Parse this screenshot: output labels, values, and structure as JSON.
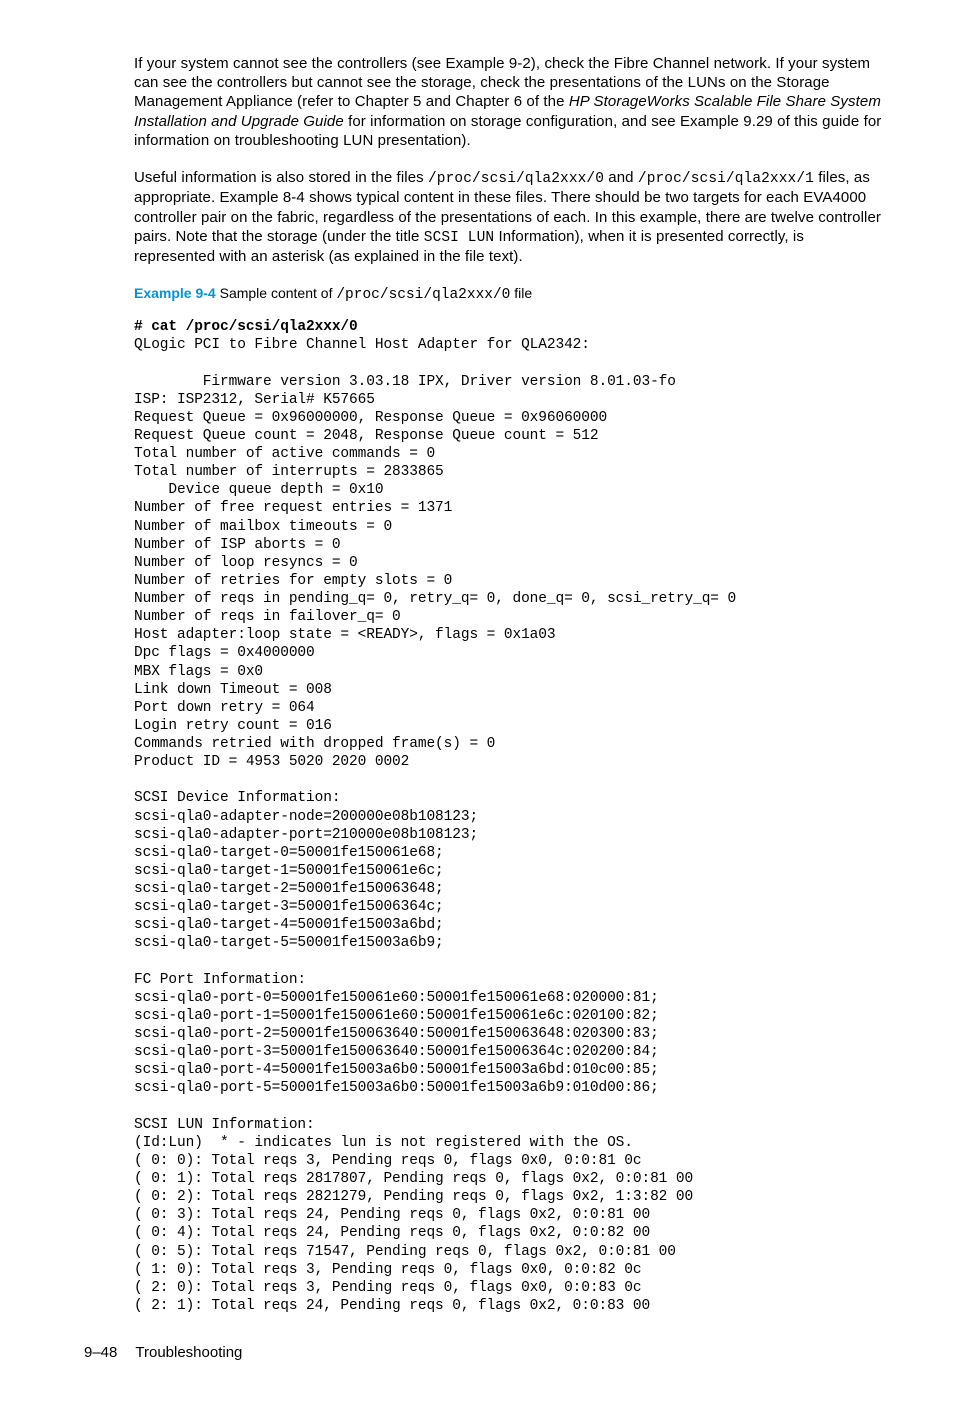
{
  "para1": {
    "t1": "If your system cannot see the controllers (see Example 9-2), check the Fibre Channel network. If your system can see the controllers but cannot see the storage, check the presentations of the LUNs on the Storage Management Appliance (refer to Chapter 5 and Chapter 6 of the ",
    "italic": "HP StorageWorks Scalable File Share System Installation and Upgrade Guide",
    "t2": " for information on storage configuration, and see Example 9.29 of this guide for information on troubleshooting LUN presentation)."
  },
  "para2": {
    "t1": "Useful information is also stored in the files ",
    "code1": "/proc/scsi/qla2xxx/0",
    "t2": " and ",
    "code2": "/proc/scsi/qla2xxx/1",
    "t3": " files, as appropriate. Example 8-4 shows typical content in these files. There should be two targets for each EVA4000 controller pair on the fabric, regardless of the presentations of each. In this example, there are twelve controller pairs. Note that the storage (under the title ",
    "code3": "SCSI LUN",
    "t4": " Information), when it is presented correctly, is represented with an asterisk (as explained in the file text)."
  },
  "example": {
    "label": "Example 9-4",
    "caption_pre": "  Sample content of ",
    "caption_code": "/proc/scsi/qla2xxx/0",
    "caption_post": " file"
  },
  "code": {
    "cmd": "# cat /proc/scsi/qla2xxx/0",
    "body": "QLogic PCI to Fibre Channel Host Adapter for QLA2342:\n\n        Firmware version 3.03.18 IPX, Driver version 8.01.03-fo\nISP: ISP2312, Serial# K57665\nRequest Queue = 0x96000000, Response Queue = 0x96060000\nRequest Queue count = 2048, Response Queue count = 512\nTotal number of active commands = 0\nTotal number of interrupts = 2833865\n    Device queue depth = 0x10\nNumber of free request entries = 1371\nNumber of mailbox timeouts = 0\nNumber of ISP aborts = 0\nNumber of loop resyncs = 0\nNumber of retries for empty slots = 0\nNumber of reqs in pending_q= 0, retry_q= 0, done_q= 0, scsi_retry_q= 0\nNumber of reqs in failover_q= 0\nHost adapter:loop state = <READY>, flags = 0x1a03\nDpc flags = 0x4000000\nMBX flags = 0x0\nLink down Timeout = 008\nPort down retry = 064\nLogin retry count = 016\nCommands retried with dropped frame(s) = 0\nProduct ID = 4953 5020 2020 0002\n\nSCSI Device Information:\nscsi-qla0-adapter-node=200000e08b108123;\nscsi-qla0-adapter-port=210000e08b108123;\nscsi-qla0-target-0=50001fe150061e68;\nscsi-qla0-target-1=50001fe150061e6c;\nscsi-qla0-target-2=50001fe150063648;\nscsi-qla0-target-3=50001fe15006364c;\nscsi-qla0-target-4=50001fe15003a6bd;\nscsi-qla0-target-5=50001fe15003a6b9;\n\nFC Port Information:\nscsi-qla0-port-0=50001fe150061e60:50001fe150061e68:020000:81;\nscsi-qla0-port-1=50001fe150061e60:50001fe150061e6c:020100:82;\nscsi-qla0-port-2=50001fe150063640:50001fe150063648:020300:83;\nscsi-qla0-port-3=50001fe150063640:50001fe15006364c:020200:84;\nscsi-qla0-port-4=50001fe15003a6b0:50001fe15003a6bd:010c00:85;\nscsi-qla0-port-5=50001fe15003a6b0:50001fe15003a6b9:010d00:86;\n\nSCSI LUN Information:\n(Id:Lun)  * - indicates lun is not registered with the OS.\n( 0: 0): Total reqs 3, Pending reqs 0, flags 0x0, 0:0:81 0c\n( 0: 1): Total reqs 2817807, Pending reqs 0, flags 0x2, 0:0:81 00\n( 0: 2): Total reqs 2821279, Pending reqs 0, flags 0x2, 1:3:82 00\n( 0: 3): Total reqs 24, Pending reqs 0, flags 0x2, 0:0:81 00\n( 0: 4): Total reqs 24, Pending reqs 0, flags 0x2, 0:0:82 00\n( 0: 5): Total reqs 71547, Pending reqs 0, flags 0x2, 0:0:81 00\n( 1: 0): Total reqs 3, Pending reqs 0, flags 0x0, 0:0:82 0c\n( 2: 0): Total reqs 3, Pending reqs 0, flags 0x0, 0:0:83 0c\n( 2: 1): Total reqs 24, Pending reqs 0, flags 0x2, 0:0:83 00"
  },
  "footer": {
    "pageno": "9–48",
    "section": "Troubleshooting"
  }
}
